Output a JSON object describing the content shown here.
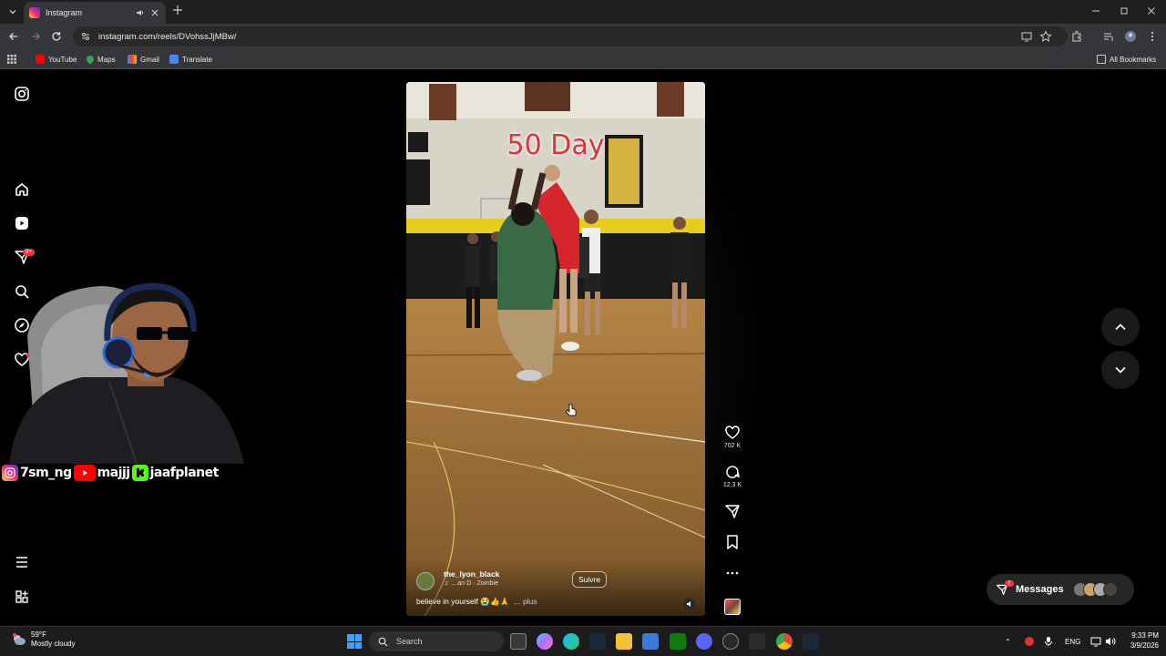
{
  "browser": {
    "tab_title": "Instagram",
    "url": "instagram.com/reels/DVohssJjMBw/",
    "bookmarks": [
      "YouTube",
      "Maps",
      "Gmail",
      "Translate"
    ],
    "all_bookmarks": "All Bookmarks"
  },
  "sidebar": {
    "icons": [
      "instagram-logo-icon",
      "home-icon",
      "reels-icon",
      "messages-icon",
      "search-icon",
      "explore-icon",
      "notifications-heart-icon",
      "menu-icon",
      "also-from-meta-icon"
    ],
    "messages_badge": "9+"
  },
  "stream_overlay": {
    "tags": [
      "7sm_ng",
      "majjj",
      "jaafplanet"
    ]
  },
  "reel": {
    "overlay_text": "50 Day",
    "username": "the_lyon_black",
    "audio": "…an·D · Zombie",
    "follow_label": "Suivre",
    "caption": "believe in yourself 😭👍🙏",
    "more_label": "... plus",
    "likes": "702 K",
    "comments": "12,3 K"
  },
  "messages": {
    "label": "Messages",
    "badge": "7"
  },
  "taskbar": {
    "temp": "59°F",
    "weather": "Mostly cloudy",
    "search_placeholder": "Search",
    "lang": "ENG",
    "time": "9:33 PM",
    "date": "3/9/2026"
  },
  "colors": {
    "accent_red": "#ff3040",
    "chrome_bg": "#35363a",
    "page_bg": "#000000"
  }
}
